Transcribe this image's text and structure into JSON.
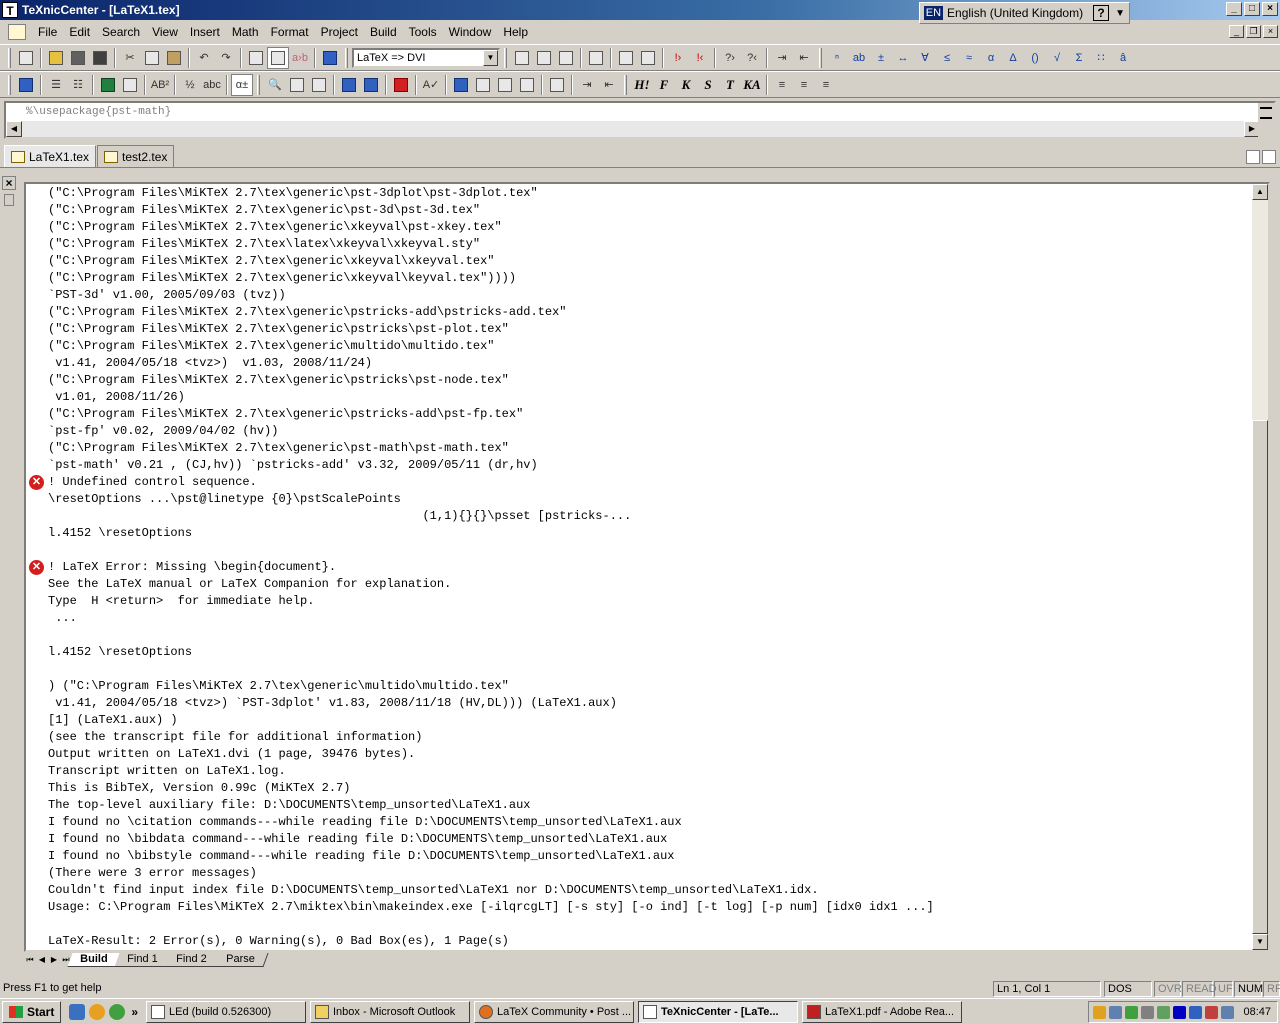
{
  "window": {
    "app_icon": "T",
    "title": "TeXnicCenter - [LaTeX1.tex]",
    "language_code": "EN",
    "language": "English (United Kingdom)"
  },
  "menu": [
    "File",
    "Edit",
    "Search",
    "View",
    "Insert",
    "Math",
    "Format",
    "Project",
    "Build",
    "Tools",
    "Window",
    "Help"
  ],
  "toolbar": {
    "output_profile": "LaTeX => DVI",
    "format_buttons": [
      "H!",
      "F",
      "K",
      "S",
      "T",
      "KA"
    ]
  },
  "editor": {
    "visible_line": "%\\usepackage{pst-math}"
  },
  "doc_tabs": [
    "LaTeX1.tex",
    "test2.tex"
  ],
  "output": {
    "lines": [
      {
        "text": "(\"C:\\Program Files\\MiKTeX 2.7\\tex\\generic\\pst-3dplot\\pst-3dplot.tex\"",
        "error": false
      },
      {
        "text": "(\"C:\\Program Files\\MiKTeX 2.7\\tex\\generic\\pst-3d\\pst-3d.tex\"",
        "error": false
      },
      {
        "text": "(\"C:\\Program Files\\MiKTeX 2.7\\tex\\generic\\xkeyval\\pst-xkey.tex\"",
        "error": false
      },
      {
        "text": "(\"C:\\Program Files\\MiKTeX 2.7\\tex\\latex\\xkeyval\\xkeyval.sty\"",
        "error": false
      },
      {
        "text": "(\"C:\\Program Files\\MiKTeX 2.7\\tex\\generic\\xkeyval\\xkeyval.tex\"",
        "error": false
      },
      {
        "text": "(\"C:\\Program Files\\MiKTeX 2.7\\tex\\generic\\xkeyval\\keyval.tex\"))))",
        "error": false
      },
      {
        "text": "`PST-3d' v1.00, 2005/09/03 (tvz))",
        "error": false
      },
      {
        "text": "(\"C:\\Program Files\\MiKTeX 2.7\\tex\\generic\\pstricks-add\\pstricks-add.tex\"",
        "error": false
      },
      {
        "text": "(\"C:\\Program Files\\MiKTeX 2.7\\tex\\generic\\pstricks\\pst-plot.tex\"",
        "error": false
      },
      {
        "text": "(\"C:\\Program Files\\MiKTeX 2.7\\tex\\generic\\multido\\multido.tex\"",
        "error": false
      },
      {
        "text": " v1.41, 2004/05/18 <tvz>)  v1.03, 2008/11/24)",
        "error": false
      },
      {
        "text": "(\"C:\\Program Files\\MiKTeX 2.7\\tex\\generic\\pstricks\\pst-node.tex\"",
        "error": false
      },
      {
        "text": " v1.01, 2008/11/26)",
        "error": false
      },
      {
        "text": "(\"C:\\Program Files\\MiKTeX 2.7\\tex\\generic\\pstricks-add\\pst-fp.tex\"",
        "error": false
      },
      {
        "text": "`pst-fp' v0.02, 2009/04/02 (hv))",
        "error": false
      },
      {
        "text": "(\"C:\\Program Files\\MiKTeX 2.7\\tex\\generic\\pst-math\\pst-math.tex\"",
        "error": false
      },
      {
        "text": "`pst-math' v0.21 , (CJ,hv)) `pstricks-add' v3.32, 2009/05/11 (dr,hv)",
        "error": false
      },
      {
        "text": "! Undefined control sequence.",
        "error": true
      },
      {
        "text": "\\resetOptions ...\\pst@linetype {0}\\pstScalePoints",
        "error": false
      },
      {
        "text": "                                                    (1,1){}{}\\psset [pstricks-...",
        "error": false
      },
      {
        "text": "l.4152 \\resetOptions",
        "error": false
      },
      {
        "text": "",
        "error": false
      },
      {
        "text": "! LaTeX Error: Missing \\begin{document}.",
        "error": true
      },
      {
        "text": "See the LaTeX manual or LaTeX Companion for explanation.",
        "error": false
      },
      {
        "text": "Type  H <return>  for immediate help.",
        "error": false
      },
      {
        "text": " ...",
        "error": false
      },
      {
        "text": "",
        "error": false
      },
      {
        "text": "l.4152 \\resetOptions",
        "error": false
      },
      {
        "text": "",
        "error": false
      },
      {
        "text": ") (\"C:\\Program Files\\MiKTeX 2.7\\tex\\generic\\multido\\multido.tex\"",
        "error": false
      },
      {
        "text": " v1.41, 2004/05/18 <tvz>) `PST-3dplot' v1.83, 2008/11/18 (HV,DL))) (LaTeX1.aux)",
        "error": false
      },
      {
        "text": "[1] (LaTeX1.aux) )",
        "error": false
      },
      {
        "text": "(see the transcript file for additional information)",
        "error": false
      },
      {
        "text": "Output written on LaTeX1.dvi (1 page, 39476 bytes).",
        "error": false
      },
      {
        "text": "Transcript written on LaTeX1.log.",
        "error": false
      },
      {
        "text": "This is BibTeX, Version 0.99c (MiKTeX 2.7)",
        "error": false
      },
      {
        "text": "The top-level auxiliary file: D:\\DOCUMENTS\\temp_unsorted\\LaTeX1.aux",
        "error": false
      },
      {
        "text": "I found no \\citation commands---while reading file D:\\DOCUMENTS\\temp_unsorted\\LaTeX1.aux",
        "error": false
      },
      {
        "text": "I found no \\bibdata command---while reading file D:\\DOCUMENTS\\temp_unsorted\\LaTeX1.aux",
        "error": false
      },
      {
        "text": "I found no \\bibstyle command---while reading file D:\\DOCUMENTS\\temp_unsorted\\LaTeX1.aux",
        "error": false
      },
      {
        "text": "(There were 3 error messages)",
        "error": false
      },
      {
        "text": "Couldn't find input index file D:\\DOCUMENTS\\temp_unsorted\\LaTeX1 nor D:\\DOCUMENTS\\temp_unsorted\\LaTeX1.idx.",
        "error": false
      },
      {
        "text": "Usage: C:\\Program Files\\MiKTeX 2.7\\miktex\\bin\\makeindex.exe [-ilqrcgLT] [-s sty] [-o ind] [-t log] [-p num] [idx0 idx1 ...]",
        "error": false
      },
      {
        "text": "",
        "error": false
      },
      {
        "text": "LaTeX-Result: 2 Error(s), 0 Warning(s), 0 Bad Box(es), 1 Page(s)",
        "error": false
      }
    ],
    "error_icon_glyph": "✕"
  },
  "output_tabs": [
    "Build",
    "Find 1",
    "Find 2",
    "Parse"
  ],
  "status": {
    "help_text": "Press F1 to get help",
    "position": "Ln 1, Col 1",
    "line_ending": "DOS",
    "indicators": [
      "OVR",
      "READ",
      "UF",
      "NUM",
      "RF"
    ]
  },
  "taskbar": {
    "start": "Start",
    "tasks": [
      {
        "label": "LEd (build 0.526300)",
        "active": false
      },
      {
        "label": "Inbox - Microsoft Outlook",
        "active": false
      },
      {
        "label": "LaTeX Community • Post ...",
        "active": false
      },
      {
        "label": "TeXnicCenter - [LaTe...",
        "active": true
      },
      {
        "label": "LaTeX1.pdf - Adobe Rea...",
        "active": false
      }
    ],
    "clock": "08:47"
  }
}
